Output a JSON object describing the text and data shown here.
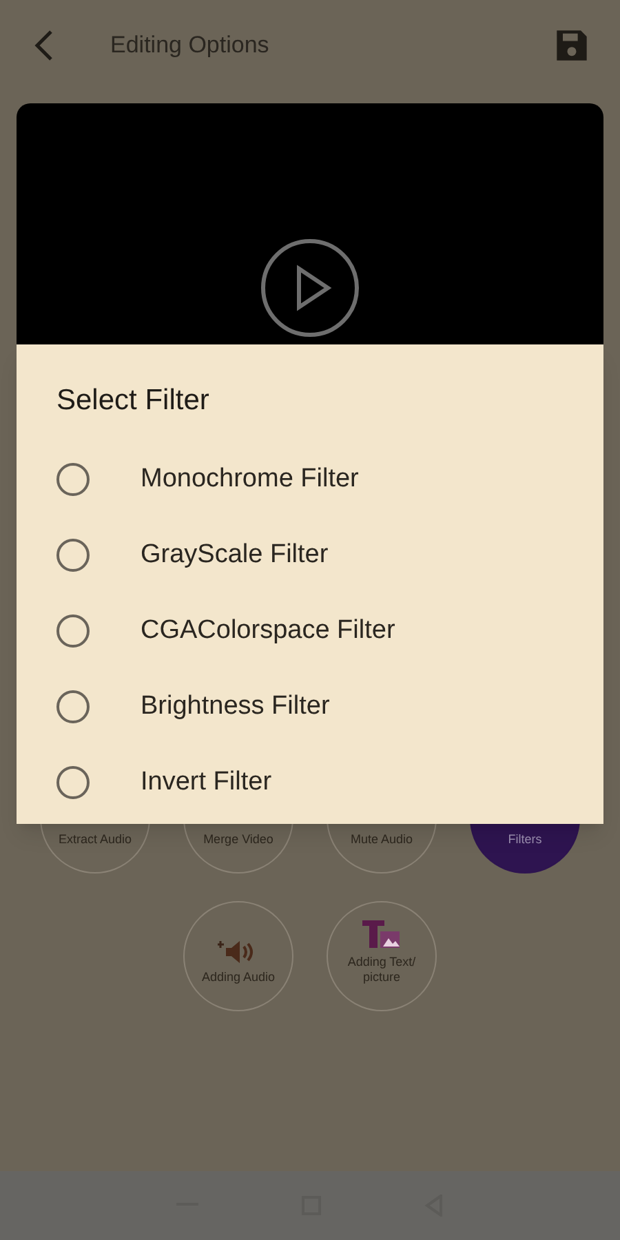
{
  "header": {
    "title": "Editing Options"
  },
  "dialog": {
    "title": "Select Filter",
    "filters": [
      {
        "label": "Monochrome Filter",
        "selected": false
      },
      {
        "label": "GrayScale Filter",
        "selected": false
      },
      {
        "label": "CGAColorspace Filter",
        "selected": false
      },
      {
        "label": "Brightness Filter",
        "selected": false
      },
      {
        "label": "Invert Filter",
        "selected": false
      }
    ]
  },
  "tools": [
    {
      "label": "Extract Audio",
      "kind": "plain",
      "selected": false
    },
    {
      "label": "Merge Video",
      "kind": "plain",
      "selected": false
    },
    {
      "label": "Mute Audio",
      "kind": "plain",
      "selected": false
    },
    {
      "label": "Filters",
      "kind": "plain",
      "selected": true
    },
    {
      "label": "Adding Audio",
      "kind": "audio",
      "selected": false
    },
    {
      "label": "Adding Text/ picture",
      "kind": "text",
      "selected": false
    }
  ]
}
